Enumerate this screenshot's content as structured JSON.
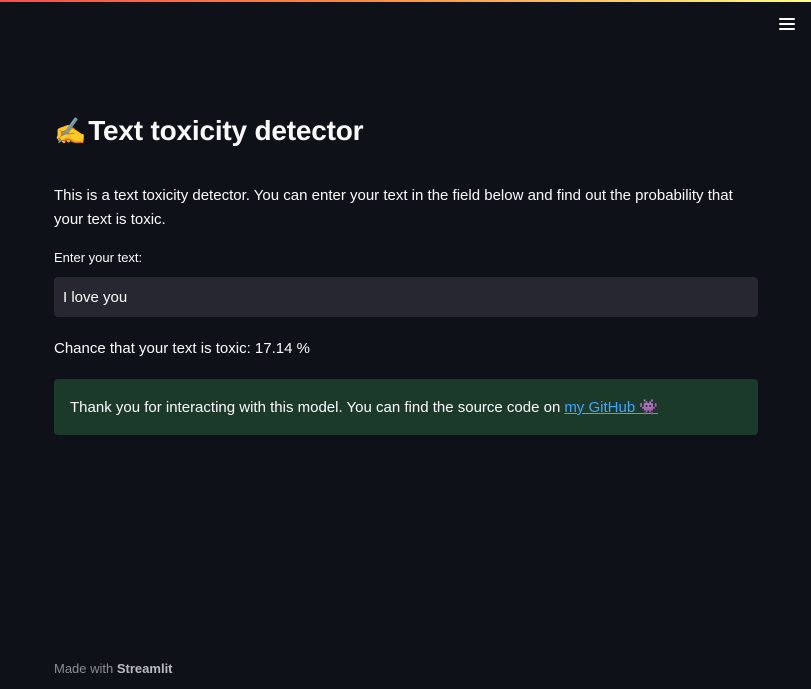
{
  "header": {
    "menu_icon": "hamburger-icon"
  },
  "main": {
    "title_emoji": "✍️",
    "title": "Text toxicity detector",
    "description": "This is a text toxicity detector. You can enter your text in the field below and find out the probability that your text is toxic.",
    "input_label": "Enter your text:",
    "input_value": "I love you",
    "result_text": "Chance that your text is toxic: 17.14 %",
    "success_text": "Thank you for interacting with this model. You can find the source code on",
    "github_link": "my GitHub 👾"
  },
  "footer": {
    "made_with": "Made with",
    "brand": "Streamlit"
  },
  "colors": {
    "background": "#0e1117",
    "input_bg": "#262730",
    "success_bg": "#1c3a2a",
    "link": "#3ea6ff"
  }
}
